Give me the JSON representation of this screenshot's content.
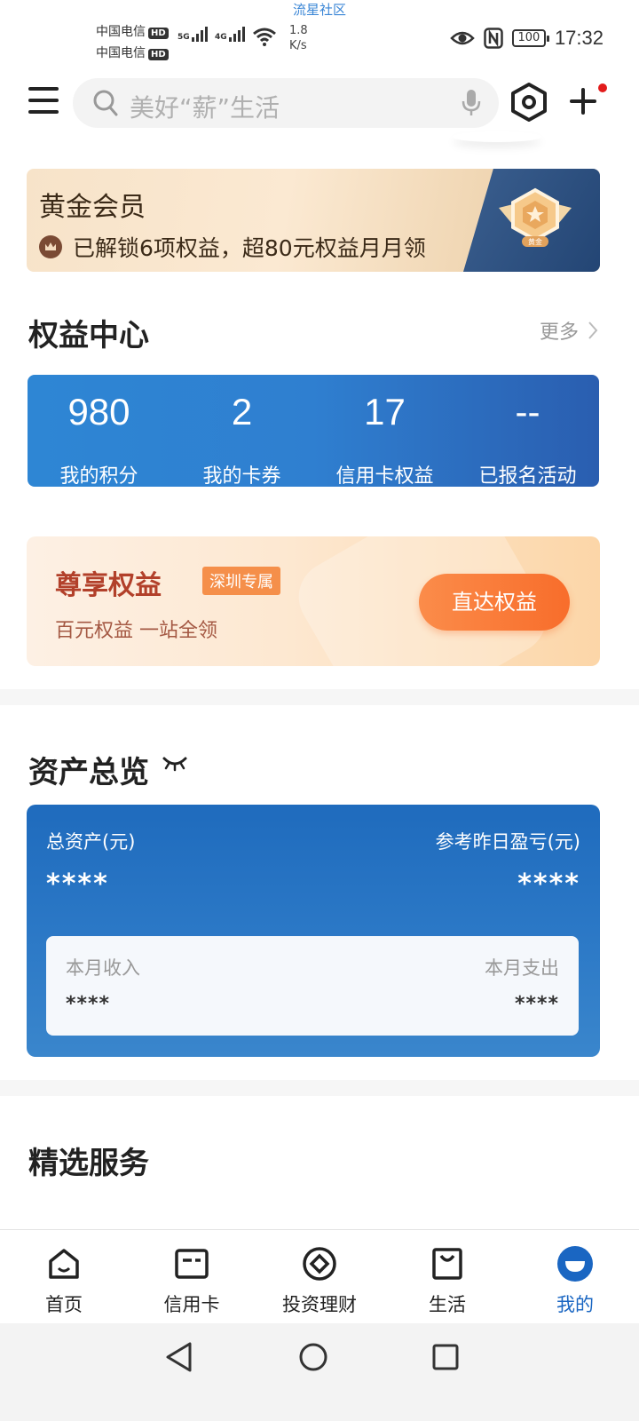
{
  "status_bar": {
    "watermark": "流星社区",
    "carrier1": "中国电信",
    "carrier2": "中国电信",
    "hd": "HD",
    "net1": "5G",
    "net2": "4G",
    "speed_value": "1.8",
    "speed_unit": "K/s",
    "battery": "100",
    "time": "17:32"
  },
  "top_bar": {
    "search_placeholder": "美好“薪”生活"
  },
  "gold_member": {
    "title": "黄金会员",
    "subtitle": "已解锁6项权益，超80元权益月月领",
    "badge_text": "黄金"
  },
  "rights_center": {
    "title": "权益中心",
    "more": "更多",
    "items": [
      {
        "value": "980",
        "label": "我的积分"
      },
      {
        "value": "2",
        "label": "我的卡券"
      },
      {
        "value": "17",
        "label": "信用卡权益"
      },
      {
        "value": "--",
        "label": "已报名活动"
      }
    ]
  },
  "exclusive": {
    "title": "尊享权益",
    "tag": "深圳专属",
    "subtitle": "百元权益 一站全领",
    "button": "直达权益"
  },
  "assets": {
    "title": "资产总览",
    "total_label": "总资产(元)",
    "total_value": "****",
    "yesterday_label": "参考昨日盈亏(元)",
    "yesterday_value": "****",
    "income_label": "本月收入",
    "income_value": "****",
    "expense_label": "本月支出",
    "expense_value": "****"
  },
  "featured": {
    "title": "精选服务"
  },
  "tab_bar": {
    "tabs": [
      {
        "label": "首页",
        "icon": "home-icon"
      },
      {
        "label": "信用卡",
        "icon": "credit-card-icon"
      },
      {
        "label": "投资理财",
        "icon": "investment-icon"
      },
      {
        "label": "生活",
        "icon": "shopping-bag-icon"
      },
      {
        "label": "我的",
        "icon": "profile-icon"
      }
    ],
    "active_index": 4,
    "active_color": "#1a66c2"
  },
  "colors": {
    "brand_blue": "#2e86d4",
    "accent_orange": "#f86d2b",
    "notification_red": "#e21b1b"
  }
}
